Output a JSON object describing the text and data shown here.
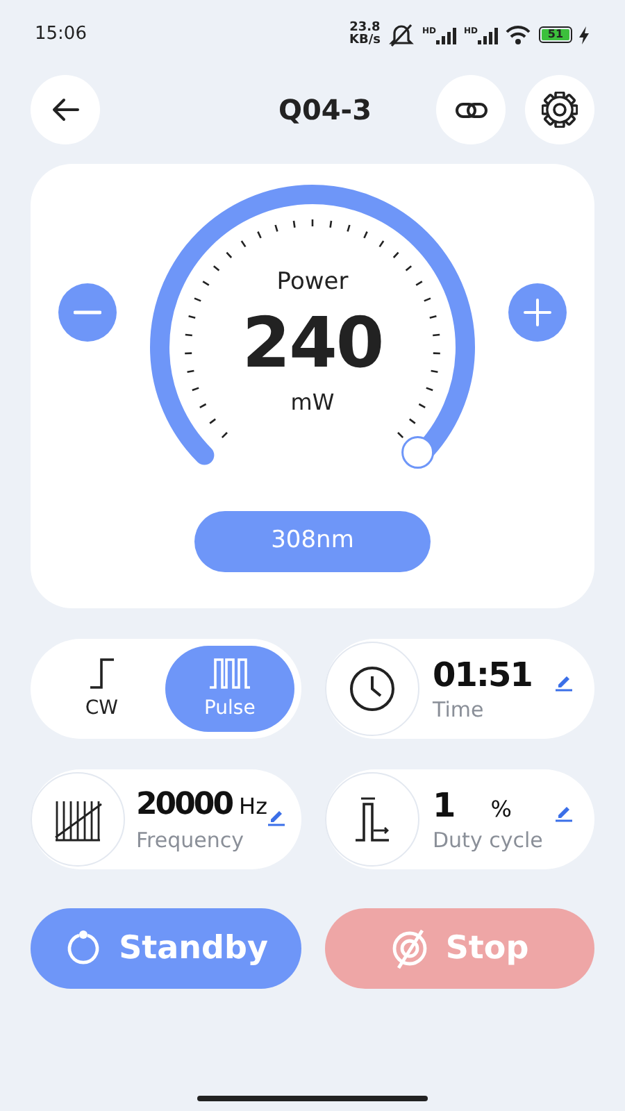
{
  "status_bar": {
    "time": "15:06",
    "net_speed": "23.8",
    "net_speed_unit": "KB/s",
    "signal_label_1": "HD",
    "signal_label_2": "HD",
    "battery": "51"
  },
  "header": {
    "title": "Q04-3"
  },
  "power": {
    "label": "Power",
    "value": "240",
    "unit": "mW",
    "wavelength": "308nm"
  },
  "modes": [
    {
      "label": "CW",
      "kind": "cw",
      "selected": false
    },
    {
      "label": "Pulse",
      "kind": "pulse",
      "selected": true
    }
  ],
  "settings": [
    {
      "kind": "time",
      "value": "01:51",
      "label": "Time"
    },
    {
      "kind": "frequency",
      "value": "20000",
      "unit": "Hz",
      "label": "Frequency"
    },
    {
      "kind": "duty",
      "value": "1",
      "unit": "%",
      "label": "Duty cycle"
    }
  ],
  "actions": [
    {
      "kind": "standby",
      "label": "Standby"
    },
    {
      "kind": "stop",
      "label": "Stop"
    }
  ]
}
